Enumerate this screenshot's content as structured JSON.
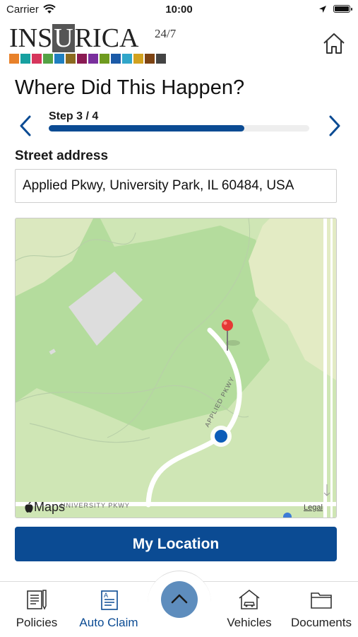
{
  "status_bar": {
    "carrier": "Carrier",
    "time": "10:00"
  },
  "brand": {
    "name_pre": "INS",
    "name_box": "U",
    "name_post": "RICA",
    "superscript": "24/7",
    "swatch_colors": [
      "#e8812a",
      "#17a0a0",
      "#d6365c",
      "#54a244",
      "#1f7fc0",
      "#8b6a1f",
      "#8a1a53",
      "#7a2f9d",
      "#6f9b1f",
      "#1b5aa7",
      "#31a6c9",
      "#d2a21f",
      "#7d4313",
      "#444444"
    ]
  },
  "page": {
    "title": "Where Did This Happen?"
  },
  "stepper": {
    "label": "Step 3 / 4",
    "progress": 0.75
  },
  "address": {
    "label": "Street address",
    "value": "Applied Pkwy, University Park, IL 60484, USA"
  },
  "map": {
    "brand": "Maps",
    "legal": "Legal",
    "road_1": "APPLIED PKWY",
    "road_2": "UNIVERSITY PKWY"
  },
  "actions": {
    "my_location": "My Location"
  },
  "tabs": [
    {
      "label": "Policies",
      "icon": "policies-icon"
    },
    {
      "label": "Auto Claim",
      "icon": "auto-claim-icon"
    },
    {
      "label": "Vehicles",
      "icon": "vehicles-icon"
    },
    {
      "label": "Documents",
      "icon": "documents-icon"
    }
  ],
  "colors": {
    "primary": "#0b4b93",
    "fab": "#5e8dbd",
    "map_green": "#cde6b2",
    "map_park": "#a8d590"
  }
}
